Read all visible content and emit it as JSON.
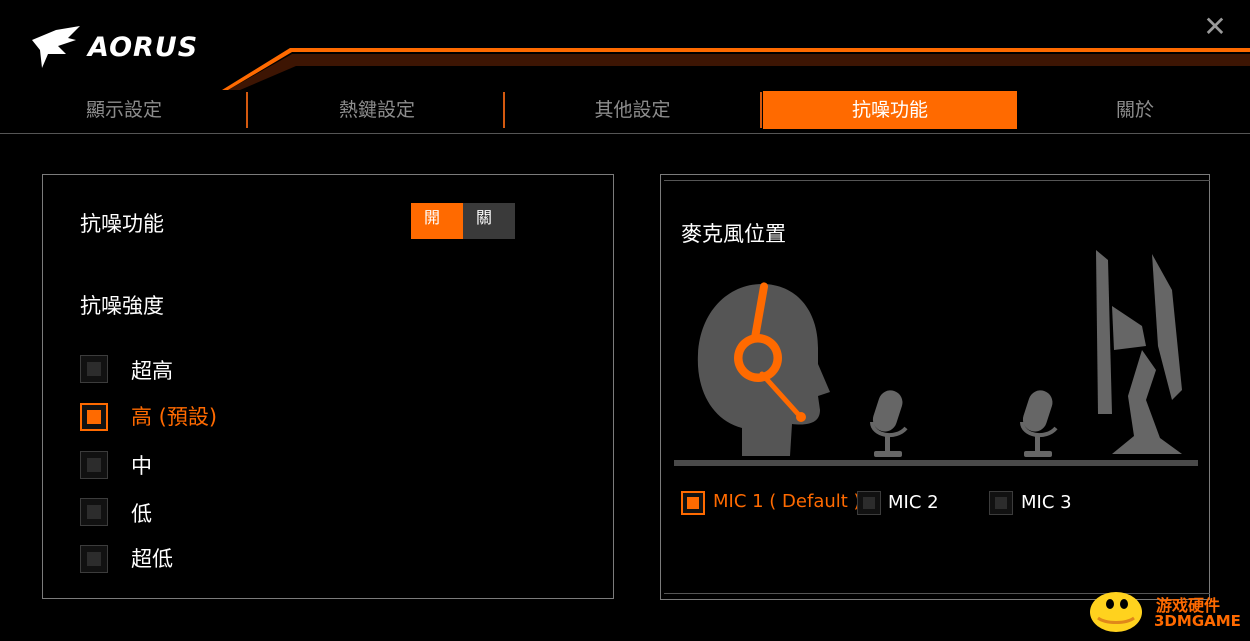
{
  "app": {
    "brand": "AORUS",
    "close_glyph": "✕"
  },
  "tabs": [
    {
      "label": "顯示設定",
      "active": false
    },
    {
      "label": "熱鍵設定",
      "active": false
    },
    {
      "label": "其他設定",
      "active": false
    },
    {
      "label": "抗噪功能",
      "active": true
    },
    {
      "label": "關於",
      "active": false
    }
  ],
  "noise_cancel": {
    "title": "抗噪功能",
    "toggle": {
      "on_label": "開",
      "off_label": "關",
      "state": "on"
    },
    "strength_title": "抗噪強度",
    "options": [
      {
        "label": "超高",
        "checked": false
      },
      {
        "label": "高 (預設)",
        "checked": true
      },
      {
        "label": "中",
        "checked": false
      },
      {
        "label": "低",
        "checked": false
      },
      {
        "label": "超低",
        "checked": false
      }
    ]
  },
  "mic_position": {
    "title": "麥克風位置",
    "options": [
      {
        "label": "MIC 1 ( Default )",
        "checked": true
      },
      {
        "label": "MIC 2",
        "checked": false
      },
      {
        "label": "MIC 3",
        "checked": false
      }
    ],
    "illustration_icons": [
      "headset-head-icon",
      "desk-mic-icon",
      "desk-mic-icon",
      "monitor-side-icon"
    ]
  },
  "watermark": {
    "top": "游戏硬件",
    "bottom": "3DMGAME"
  },
  "colors": {
    "accent": "#ff6a00",
    "background": "#000000",
    "panel_border": "#7b7b7b",
    "inactive_tab": "#8c8c8c"
  }
}
